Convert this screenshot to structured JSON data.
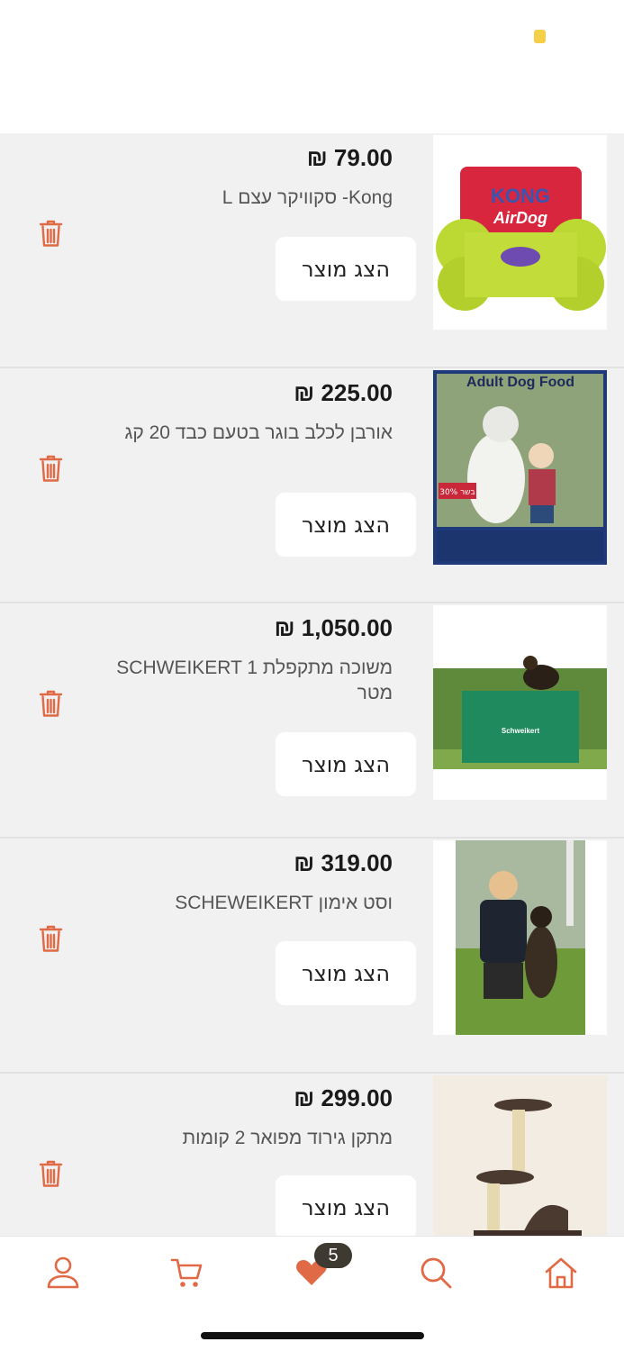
{
  "colors": {
    "accent": "#e06a46",
    "background": "#f1f1f1",
    "badge": "#3f3a31"
  },
  "items": [
    {
      "price": "₪ 79.00",
      "title": "Kong- סקוויקר עצם L",
      "button_label": "הצג מוצר",
      "image_icon": "kong-airdog-bone-image",
      "image_text": [
        "KONG",
        "AirDog"
      ]
    },
    {
      "price": "₪ 225.00",
      "title": "אורבן לכלב בוגר בטעם כבד 20 קג",
      "button_label": "הצג מוצר",
      "image_icon": "adult-dog-food-bag-image",
      "image_text": [
        "Adult Dog Food",
        "30% בשר"
      ]
    },
    {
      "price": "₪ 1,050.00",
      "title": "משוכה מתקפלת SCHWEIKERT 1 מטר",
      "button_label": "הצג מוצר",
      "image_icon": "dog-hurdle-image",
      "image_text": [
        "Schweikert"
      ]
    },
    {
      "price": "₪ 319.00",
      "title": "וסט אימון SCHEWEIKERT",
      "button_label": "הצג מוצר",
      "image_icon": "trainer-vest-image",
      "image_text": []
    },
    {
      "price": "₪ 299.00",
      "title": "מתקן גירוד מפואר 2 קומות",
      "button_label": "הצג מוצר",
      "image_icon": "cat-scratcher-image",
      "image_text": []
    }
  ],
  "tabbar": {
    "tabs": [
      "profile-icon",
      "cart-icon",
      "heart-icon",
      "search-icon",
      "home-icon"
    ],
    "wishlist_count": "5"
  }
}
